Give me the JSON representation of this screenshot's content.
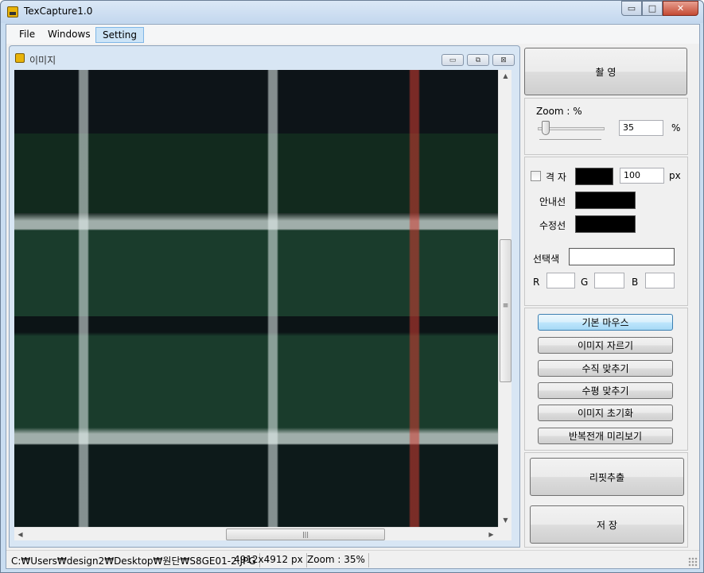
{
  "window": {
    "title": "TexCapture1.0",
    "minimize": "▭",
    "maximize": "□",
    "close": "✕"
  },
  "menu": {
    "items": [
      {
        "label": "File"
      },
      {
        "label": "Windows"
      },
      {
        "label": "Setting"
      }
    ]
  },
  "child_window": {
    "title": "이미지",
    "minimize": "▭",
    "restore": "⧉",
    "close": "⊠"
  },
  "image": {
    "description_icon": "plaid-fabric-image"
  },
  "scroll": {
    "up": "▲",
    "down": "▼",
    "left": "◀",
    "right": "▶",
    "v_grip": "≡",
    "h_grip": "|||"
  },
  "panel": {
    "capture_button": "촬 영",
    "zoom": {
      "label": "Zoom : %",
      "value": "35",
      "unit": "%",
      "level": 35
    },
    "grid": {
      "label": "격 자",
      "checked": false,
      "size_value": "100",
      "size_unit": "px",
      "color": "#000000"
    },
    "guide_line": {
      "label": "안내선",
      "color": "#000000"
    },
    "edit_line": {
      "label": "수정선",
      "color": "#000000"
    },
    "selected_color": {
      "label": "선택색",
      "value": ""
    },
    "rgb": {
      "r_label": "R",
      "g_label": "G",
      "b_label": "B",
      "r": "",
      "g": "",
      "b": ""
    },
    "tools": [
      {
        "label": "기본 마우스",
        "active": true
      },
      {
        "label": "이미지 자르기",
        "active": false
      },
      {
        "label": "수직 맞추기",
        "active": false
      },
      {
        "label": "수평 맞추기",
        "active": false
      },
      {
        "label": "이미지 초기화",
        "active": false
      },
      {
        "label": "반복전개 미리보기",
        "active": false
      }
    ],
    "repeat_extract_button": "리핏추출",
    "save_button": "저 장"
  },
  "status": {
    "path": "C:₩Users₩design2₩Desktop₩원단₩S8GE01-2.JPG",
    "dimensions": "4912x4912 px",
    "zoom": "Zoom : 35%"
  }
}
